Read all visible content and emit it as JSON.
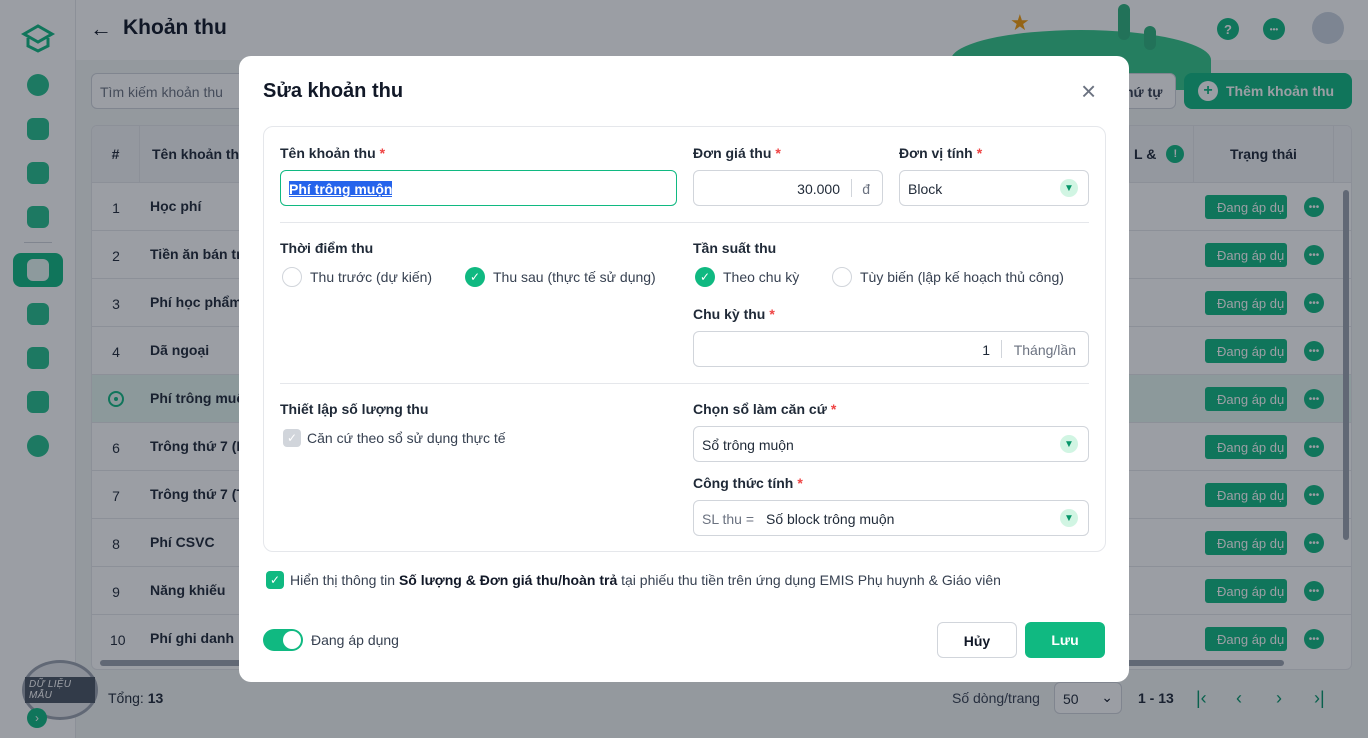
{
  "app": {
    "page_title": "Khoản thu",
    "search_placeholder": "Tìm kiếm khoản thu",
    "order_button": "hứ tự",
    "add_button": "Thêm khoản thu",
    "help_glyph": "?",
    "more_glyph": "•••",
    "stamp_text": "DỮ LIỆU MẪU"
  },
  "table": {
    "col_index": "#",
    "col_name": "Tên khoản th",
    "col_partial": "L &",
    "col_status": "Trạng thái",
    "status_text": "Đang áp dụ",
    "rows": [
      {
        "index": "1",
        "name": "Học phí"
      },
      {
        "index": "2",
        "name": "Tiền ăn bán tr"
      },
      {
        "index": "3",
        "name": "Phí học phẩm"
      },
      {
        "index": "4",
        "name": "Dã ngoại"
      },
      {
        "index": "",
        "name": "Phí trông muộ"
      },
      {
        "index": "6",
        "name": "Trông thứ 7 (I"
      },
      {
        "index": "7",
        "name": "Trông thứ 7 (T"
      },
      {
        "index": "8",
        "name": "Phí CSVC"
      },
      {
        "index": "9",
        "name": "Năng khiếu"
      },
      {
        "index": "10",
        "name": "Phí ghi danh"
      }
    ]
  },
  "footer": {
    "total_label": "Tổng:",
    "total_value": "13",
    "rows_per_page_label": "Số dòng/trang",
    "rows_per_page_value": "50",
    "range": "1 - 13"
  },
  "modal": {
    "title": "Sửa khoản thu",
    "name_label": "Tên khoản thu",
    "name_value": "Phí trông muộn",
    "price_label": "Đơn giá thu",
    "price_value": "30.000",
    "price_unit": "đ",
    "unit_label": "Đơn vị tính",
    "unit_value": "Block",
    "timing_label": "Thời điểm thu",
    "timing_opt1": "Thu trước (dự kiến)",
    "timing_opt2": "Thu sau (thực tế sử dụng)",
    "freq_label": "Tần suất thu",
    "freq_opt1": "Theo chu kỳ",
    "freq_opt2": "Tùy biến (lập kế hoạch thủ công)",
    "cycle_label": "Chu kỳ thu",
    "cycle_value": "1",
    "cycle_unit": "Tháng/lần",
    "qty_label": "Thiết lập số lượng thu",
    "qty_check": "Căn cứ theo sổ sử dụng thực tế",
    "book_label": "Chọn sổ làm căn cứ",
    "book_value": "Sổ trông muộn",
    "formula_label": "Công thức tính",
    "formula_prefix": "SL thu =",
    "formula_value": "Số block trông muộn",
    "note_pre": "Hiển thị thông tin ",
    "note_bold": "Số lượng & Đơn giá thu/hoàn trả",
    "note_post": " tại phiếu thu tiền trên ứng dụng EMIS Phụ huynh & Giáo viên",
    "active_label": "Đang áp dụng",
    "cancel": "Hủy",
    "save": "Lưu"
  },
  "colors": {
    "accent": "#10b981",
    "selection": "#2563eb",
    "required": "#ef4444"
  }
}
